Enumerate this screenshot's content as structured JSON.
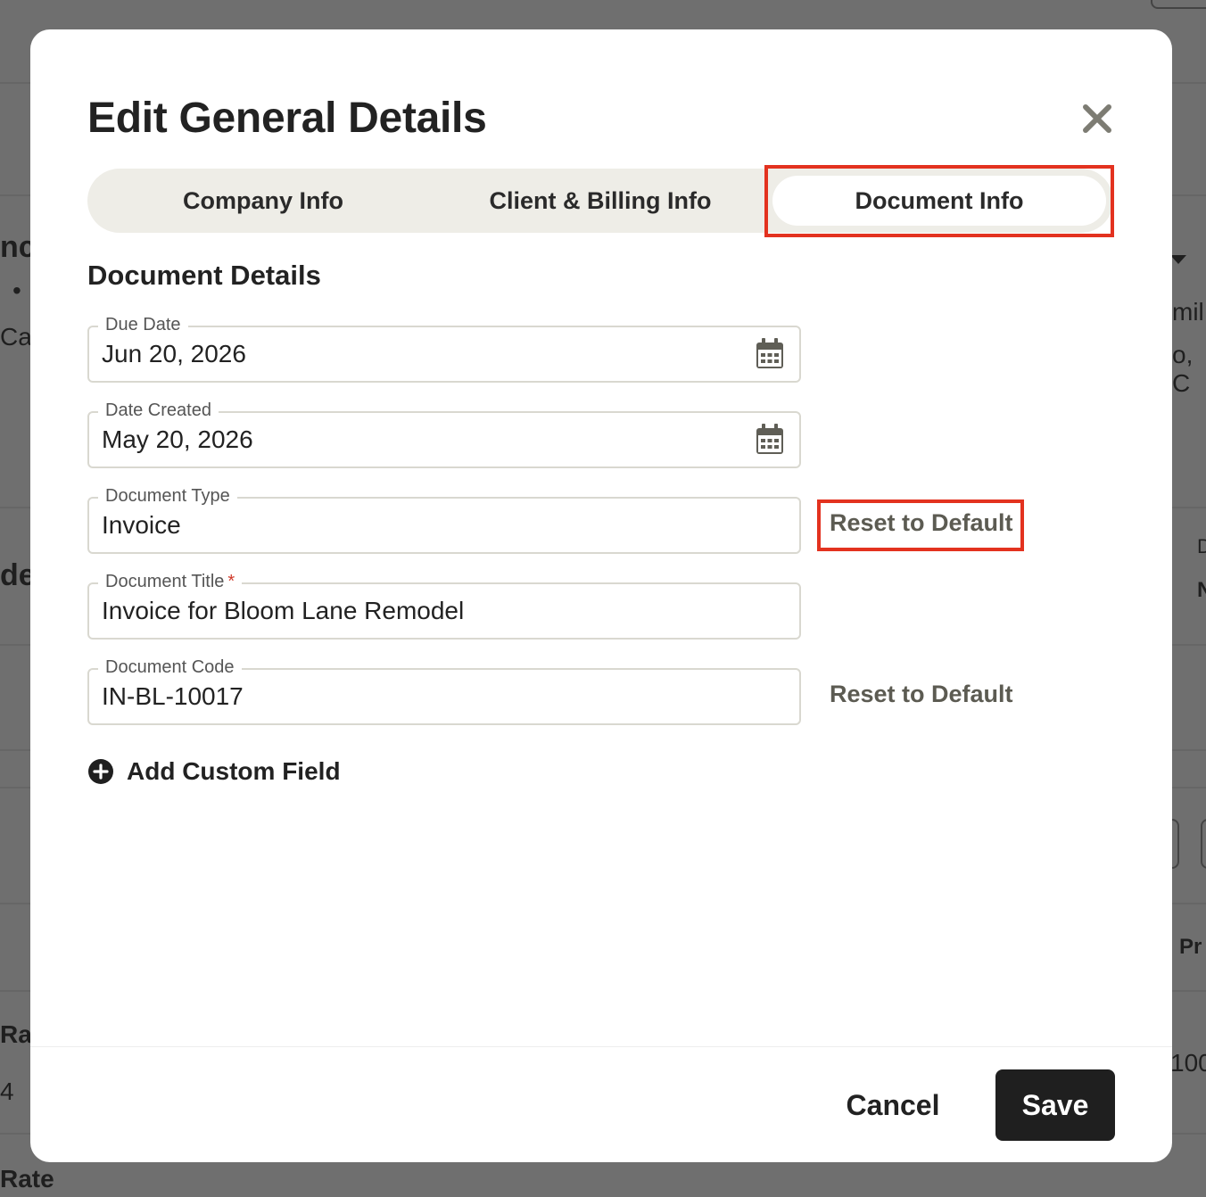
{
  "background": {
    "left_fragments": [
      "nc",
      "•",
      "Cal",
      "de",
      "Rate",
      "4",
      "Rate"
    ],
    "right_fragments": [
      "mil",
      "o, C",
      "D",
      "N",
      "Pr",
      "100"
    ]
  },
  "modal": {
    "title": "Edit General Details",
    "close_icon": "close-icon",
    "tabs": [
      {
        "label": "Company Info",
        "active": false
      },
      {
        "label": "Client & Billing Info",
        "active": false
      },
      {
        "label": "Document Info",
        "active": true
      }
    ],
    "section_title": "Document Details",
    "fields": {
      "due_date": {
        "label": "Due Date",
        "value": "Jun 20, 2026",
        "icon": "calendar-icon"
      },
      "date_created": {
        "label": "Date Created",
        "value": "May 20, 2026",
        "icon": "calendar-icon"
      },
      "document_type": {
        "label": "Document Type",
        "value": "Invoice",
        "reset_label": "Reset to Default"
      },
      "document_title": {
        "label": "Document Title",
        "required_mark": "*",
        "value": "Invoice for Bloom Lane Remodel"
      },
      "document_code": {
        "label": "Document Code",
        "value": "IN-BL-10017",
        "reset_label": "Reset to Default"
      }
    },
    "add_custom_field": {
      "label": "Add Custom Field",
      "icon": "plus-circle-icon"
    },
    "footer": {
      "cancel_label": "Cancel",
      "save_label": "Save"
    }
  },
  "colors": {
    "highlight": "#e3321f",
    "tab_track": "#eeede7",
    "primary_button": "#1f1f1f",
    "reset_link": "#5c5b52"
  }
}
